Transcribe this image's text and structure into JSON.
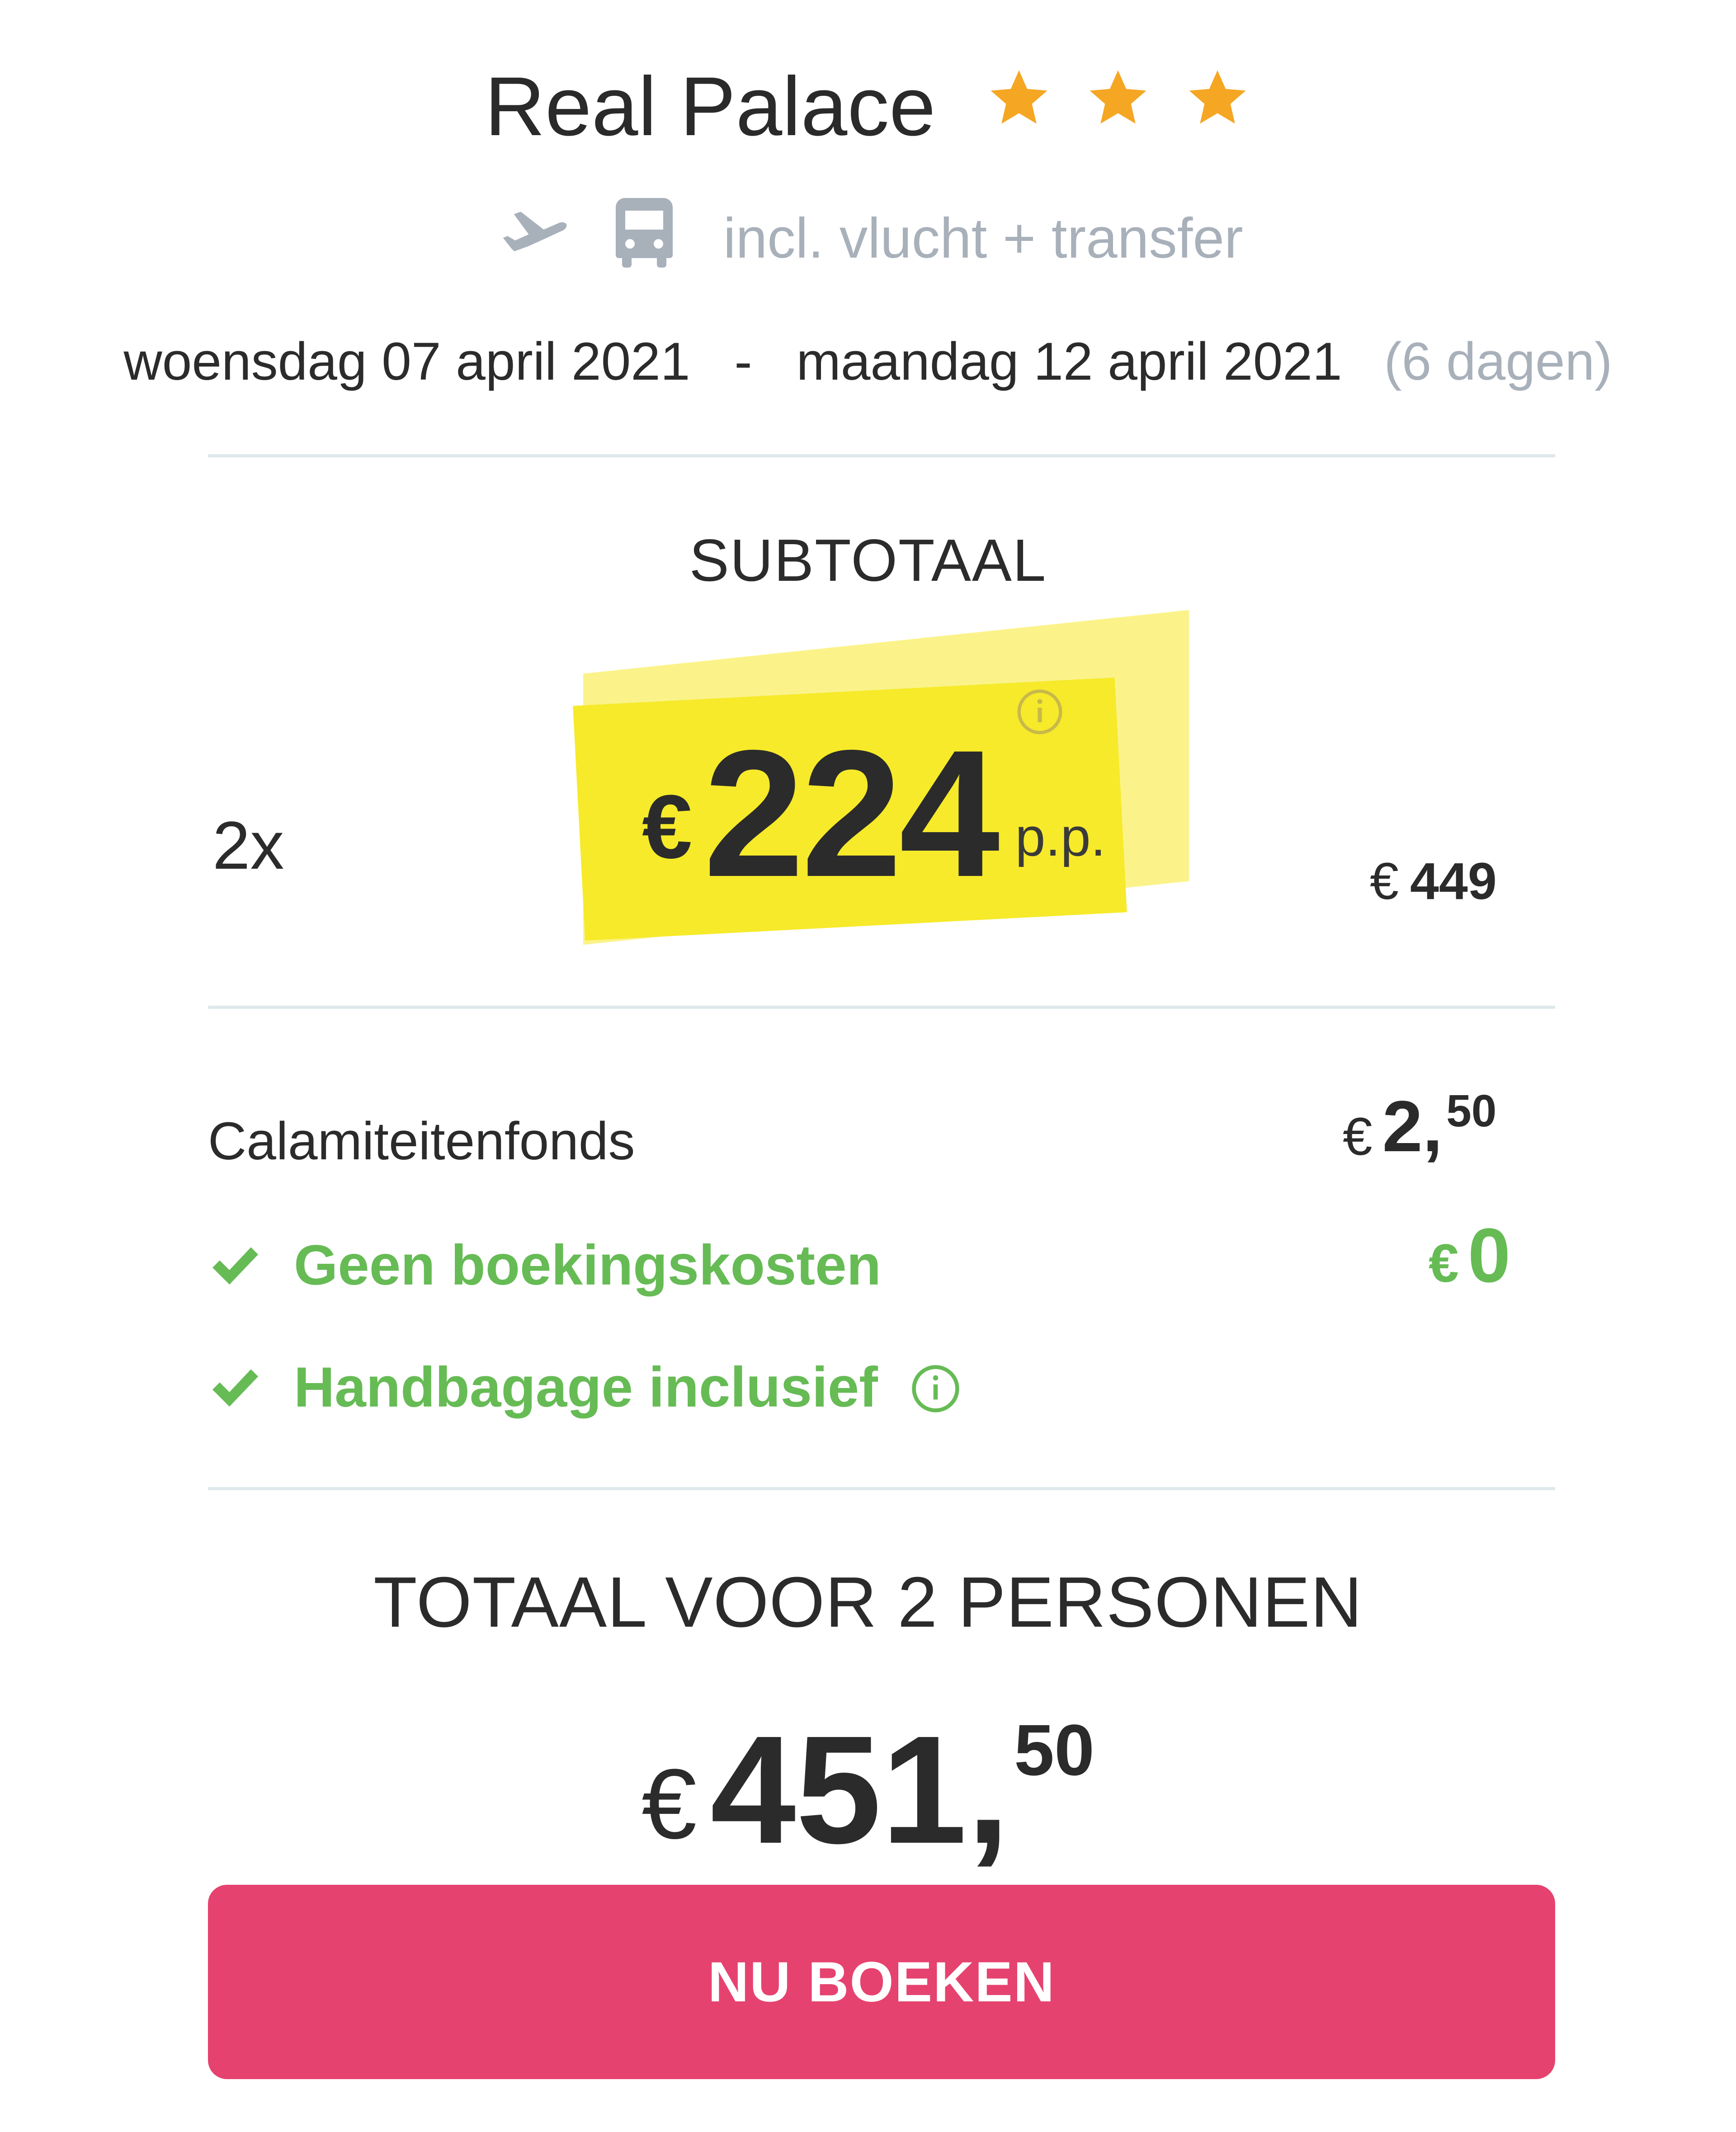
{
  "header": {
    "hotel_name": "Real Palace",
    "star_rating": 3,
    "star_color": "#f5a623",
    "includes_text": "incl. vlucht + transfer",
    "includes_icons": [
      "plane-icon",
      "bus-icon"
    ]
  },
  "dates": {
    "start": "woensdag 07 april 2021",
    "separator": "-",
    "end": "maandag 12 april 2021",
    "duration": "(6 dagen)"
  },
  "subtotal": {
    "label": "SUBTOTAAL",
    "quantity": "2x",
    "currency": "€",
    "price_per_person": "224",
    "per_person_suffix": "p.p.",
    "line_total_currency": "€",
    "line_total": "449"
  },
  "fees": {
    "calamity_label": "Calamiteitenfonds",
    "calamity_currency": "€",
    "calamity_int": "2,",
    "calamity_dec": "50",
    "booking_costs_label": "Geen boekingskosten",
    "booking_costs_currency": "€",
    "booking_costs_value": "0",
    "hand_luggage_label": "Handbagage inclusief"
  },
  "total": {
    "label": "TOTAAL VOOR 2 PERSONEN",
    "currency": "€",
    "int": "451,",
    "dec": "50"
  },
  "cta": {
    "label": "NU BOEKEN"
  },
  "colors": {
    "accent_pink": "#e6426f",
    "success_green": "#66bb55",
    "highlight_yellow": "#f6ea2a",
    "muted_gray": "#a8b0ba"
  }
}
